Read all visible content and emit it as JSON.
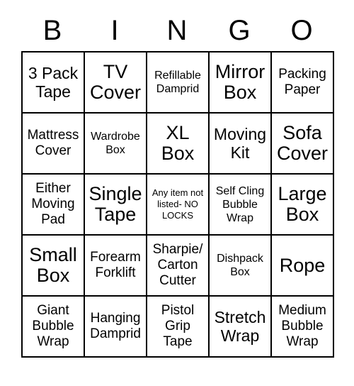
{
  "card": {
    "headers": [
      "B",
      "I",
      "N",
      "G",
      "O"
    ],
    "rows": [
      [
        {
          "text": "3 Pack Tape",
          "size": "lg"
        },
        {
          "text": "TV Cover",
          "size": "xl"
        },
        {
          "text": "Refillable Damprid",
          "size": "sm"
        },
        {
          "text": "Mirror Box",
          "size": "xl"
        },
        {
          "text": "Packing Paper",
          "size": "md"
        }
      ],
      [
        {
          "text": "Mattress Cover",
          "size": "md"
        },
        {
          "text": "Wardrobe Box",
          "size": "sm"
        },
        {
          "text": "XL Box",
          "size": "xl"
        },
        {
          "text": "Moving Kit",
          "size": "lg"
        },
        {
          "text": "Sofa Cover",
          "size": "xl"
        }
      ],
      [
        {
          "text": "Either Moving Pad",
          "size": "md"
        },
        {
          "text": "Single Tape",
          "size": "xl"
        },
        {
          "text": "Any item not listed- NO LOCKS",
          "size": "xs"
        },
        {
          "text": "Self Cling Bubble Wrap",
          "size": "sm"
        },
        {
          "text": "Large Box",
          "size": "xl"
        }
      ],
      [
        {
          "text": "Small Box",
          "size": "xl"
        },
        {
          "text": "Forearm Forklift",
          "size": "md"
        },
        {
          "text": "Sharpie/ Carton Cutter",
          "size": "md"
        },
        {
          "text": "Dishpack Box",
          "size": "sm"
        },
        {
          "text": "Rope",
          "size": "xl"
        }
      ],
      [
        {
          "text": "Giant Bubble Wrap",
          "size": "md"
        },
        {
          "text": "Hanging Damprid",
          "size": "md"
        },
        {
          "text": "Pistol Grip Tape",
          "size": "md"
        },
        {
          "text": "Stretch Wrap",
          "size": "lg"
        },
        {
          "text": "Medium Bubble Wrap",
          "size": "md"
        }
      ]
    ]
  }
}
